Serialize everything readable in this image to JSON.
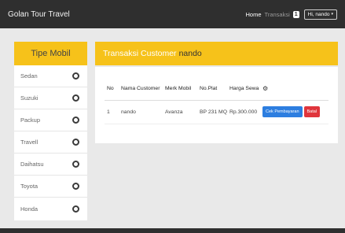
{
  "navbar": {
    "brand": "Golan Tour Travel",
    "home": "Home",
    "transaksi": "Transaksi",
    "badge": "1",
    "user": "Hi, nando",
    "caret": "▾"
  },
  "sidebar": {
    "title": "Tipe Mobil",
    "items": [
      {
        "label": "Sedan"
      },
      {
        "label": "Suzuki"
      },
      {
        "label": "Packup"
      },
      {
        "label": "Travell"
      },
      {
        "label": "Daihatsu"
      },
      {
        "label": "Toyota"
      },
      {
        "label": "Honda"
      }
    ]
  },
  "main": {
    "title": "Transaksi Customer",
    "customer": "nando",
    "columns": [
      "No",
      "Nama Customer",
      "Merk Mobil",
      "No.Plat",
      "Harga Sewa"
    ],
    "gear_icon": "⚙",
    "rows": [
      {
        "no": "1",
        "nama": "nando",
        "merk": "Avanza",
        "plat": "BP 231 MQ",
        "harga": "Rp.300.000"
      }
    ],
    "btn_cek": "Cek Pembayaran",
    "btn_batal": "Batal"
  },
  "colors": {
    "accent": "#f6c21a",
    "navbar": "#2f2f2f",
    "primary": "#2d7ee0",
    "danger": "#e0353c"
  }
}
